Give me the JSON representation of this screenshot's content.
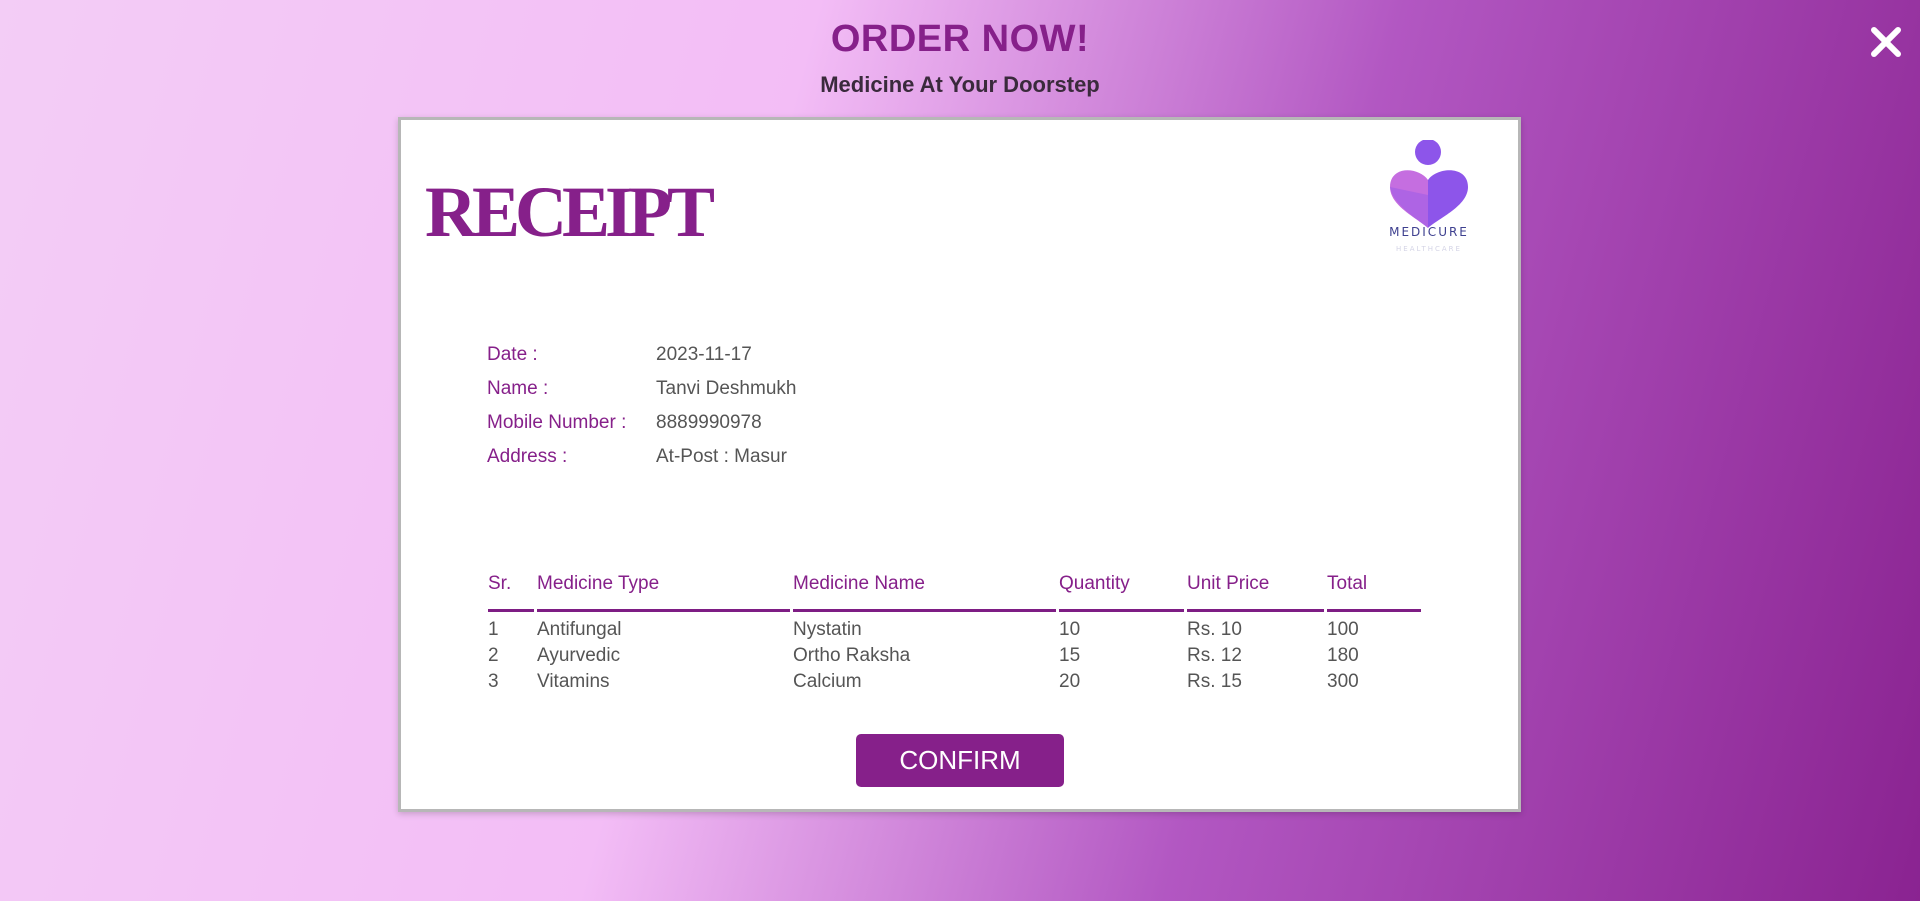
{
  "header": {
    "title": "ORDER NOW!",
    "subtitle": "Medicine At Your Doorstep"
  },
  "receipt": {
    "title": "RECEIPT",
    "logo_text": "MEDICURE",
    "logo_subtext": "HEALTHCARE",
    "info": [
      {
        "label": "Date :",
        "value": "2023-11-17"
      },
      {
        "label": "Name :",
        "value": "Tanvi Deshmukh"
      },
      {
        "label": "Mobile Number :",
        "value": "8889990978"
      },
      {
        "label": "Address :",
        "value": "At-Post : Masur"
      }
    ],
    "table": {
      "columns": [
        "Sr.",
        "Medicine Type",
        "Medicine Name",
        "Quantity",
        "Unit Price",
        "Total"
      ],
      "rows": [
        [
          "1",
          "Antifungal",
          "Nystatin",
          "10",
          "Rs. 10",
          "100"
        ],
        [
          "2",
          "Ayurvedic",
          "Ortho Raksha",
          "15",
          "Rs. 12",
          "180"
        ],
        [
          "3",
          "Vitamins",
          "Calcium",
          "20",
          "Rs. 15",
          "300"
        ]
      ]
    },
    "confirm_label": "CONFIRM"
  },
  "icons": {
    "close": "close-icon",
    "logo": "medicure-logo-icon"
  },
  "colors": {
    "accent": "#86208a",
    "label_text": "#86208a",
    "value_text": "#555555",
    "button_bg": "#86208a",
    "button_text": "#ffffff",
    "close_icon": "#ffffff"
  }
}
